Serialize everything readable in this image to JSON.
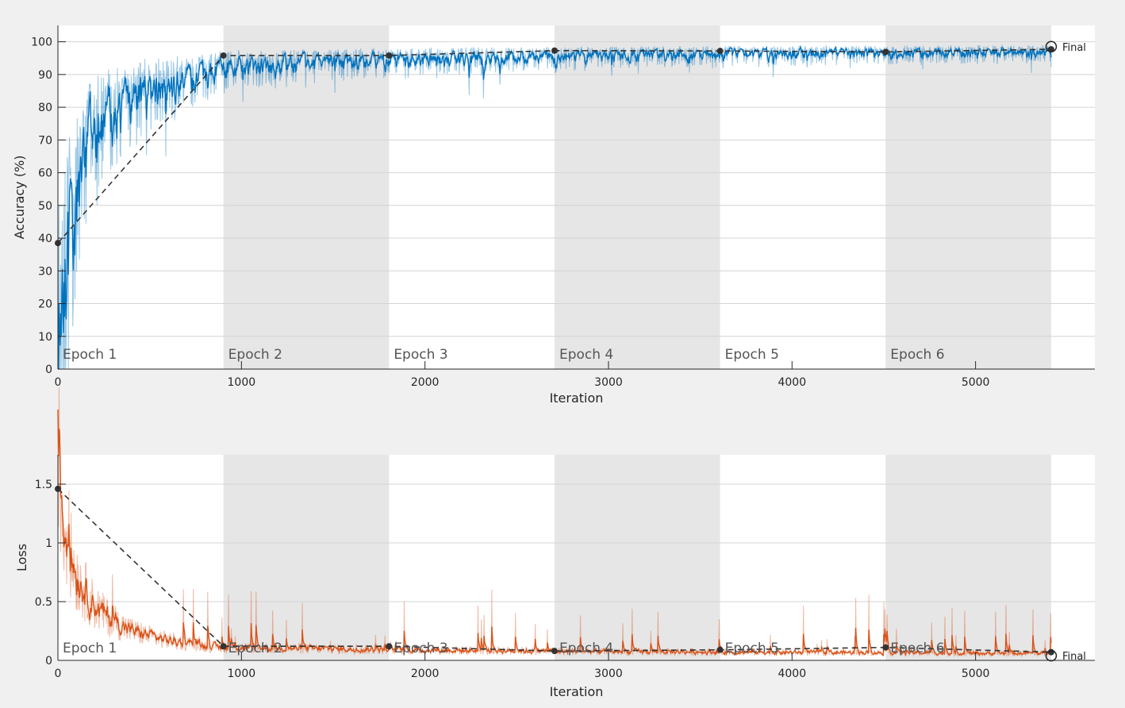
{
  "chart_data": [
    {
      "type": "line",
      "title": "",
      "xlabel": "Iteration",
      "ylabel": "Accuracy (%)",
      "xlim": [
        0,
        5650
      ],
      "ylim": [
        0,
        105
      ],
      "grid": true,
      "x_ticks": [
        0,
        1000,
        2000,
        3000,
        4000,
        5000
      ],
      "y_ticks": [
        0,
        10,
        20,
        30,
        40,
        50,
        60,
        70,
        80,
        90,
        100
      ],
      "y_tick_labels": [
        "0",
        "10",
        "20",
        "30",
        "40",
        "50",
        "60",
        "70",
        "80",
        "90",
        "100"
      ],
      "epochs": [
        {
          "label": "Epoch 1",
          "start": 0,
          "end": 902
        },
        {
          "label": "Epoch 2",
          "start": 902,
          "end": 1804
        },
        {
          "label": "Epoch 3",
          "start": 1804,
          "end": 2706
        },
        {
          "label": "Epoch 4",
          "start": 2706,
          "end": 3608
        },
        {
          "label": "Epoch 5",
          "start": 3608,
          "end": 4510
        },
        {
          "label": "Epoch 6",
          "start": 4510,
          "end": 5412
        }
      ],
      "color": "#0072bd",
      "validation": {
        "x": [
          0,
          902,
          1804,
          2706,
          3608,
          4510,
          5412
        ],
        "y": [
          38.5,
          95.8,
          95.8,
          97.3,
          97.2,
          96.9,
          97.7
        ]
      },
      "final": {
        "label": "Final",
        "x": 5412,
        "y": 98.5
      },
      "training_trend": {
        "x": [
          0,
          20,
          50,
          100,
          150,
          200,
          300,
          400,
          500,
          600,
          700,
          800,
          902,
          1200,
          1500,
          1804,
          2200,
          2706,
          3100,
          3608,
          4000,
          4510,
          5000,
          5412
        ],
        "y": [
          30,
          55,
          72,
          82,
          86,
          88,
          90,
          91.5,
          92.5,
          93.5,
          94.5,
          95.5,
          96,
          96.5,
          97,
          97.2,
          97.5,
          97.8,
          98,
          98.1,
          98.2,
          98.3,
          98.4,
          98.5
        ]
      }
    },
    {
      "type": "line",
      "title": "",
      "xlabel": "Iteration",
      "ylabel": "Loss",
      "xlim": [
        0,
        5650
      ],
      "ylim": [
        0,
        1.75
      ],
      "grid": true,
      "x_ticks": [
        0,
        1000,
        2000,
        3000,
        4000,
        5000
      ],
      "y_ticks": [
        0,
        0.5,
        1,
        1.5
      ],
      "y_tick_labels": [
        "0",
        "0.5",
        "1",
        "1.5"
      ],
      "epochs": [
        {
          "label": "Epoch 1",
          "start": 0,
          "end": 902
        },
        {
          "label": "Epoch 2",
          "start": 902,
          "end": 1804
        },
        {
          "label": "Epoch 3",
          "start": 1804,
          "end": 2706
        },
        {
          "label": "Epoch 4",
          "start": 2706,
          "end": 3608
        },
        {
          "label": "Epoch 5",
          "start": 3608,
          "end": 4510
        },
        {
          "label": "Epoch 6",
          "start": 4510,
          "end": 5412
        }
      ],
      "color": "#d95319",
      "validation": {
        "x": [
          0,
          902,
          1804,
          2706,
          3608,
          4510,
          5412
        ],
        "y": [
          1.46,
          0.12,
          0.12,
          0.08,
          0.09,
          0.11,
          0.07
        ]
      },
      "final": {
        "label": "Final",
        "x": 5412,
        "y": 0.04
      },
      "training_trend": {
        "x": [
          0,
          10,
          30,
          60,
          100,
          150,
          200,
          300,
          400,
          500,
          600,
          700,
          800,
          902,
          1200,
          1500,
          1804,
          2200,
          2706,
          3100,
          3608,
          4000,
          4510,
          5000,
          5412
        ],
        "y": [
          1.6,
          1.2,
          0.95,
          0.78,
          0.6,
          0.48,
          0.38,
          0.27,
          0.21,
          0.17,
          0.14,
          0.12,
          0.1,
          0.09,
          0.085,
          0.08,
          0.075,
          0.07,
          0.065,
          0.06,
          0.06,
          0.055,
          0.055,
          0.05,
          0.05
        ]
      }
    }
  ]
}
